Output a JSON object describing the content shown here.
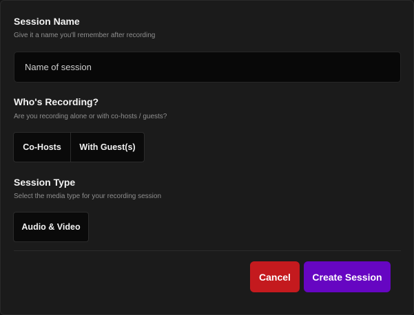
{
  "session_name": {
    "title": "Session Name",
    "subtitle": "Give it a name you'll remember after recording",
    "placeholder": "Name of session",
    "value": ""
  },
  "recording": {
    "title": "Who's Recording?",
    "subtitle": "Are you recording alone or with co-hosts / guests?",
    "options": [
      "Co-Hosts",
      "With Guest(s)"
    ]
  },
  "session_type": {
    "title": "Session Type",
    "subtitle": "Select the media type for your recording session",
    "options": [
      "Audio & Video"
    ]
  },
  "actions": {
    "cancel_label": "Cancel",
    "create_label": "Create Session"
  },
  "colors": {
    "cancel": "#c41a1e",
    "create": "#6606c2",
    "background": "#1b1b1b"
  }
}
